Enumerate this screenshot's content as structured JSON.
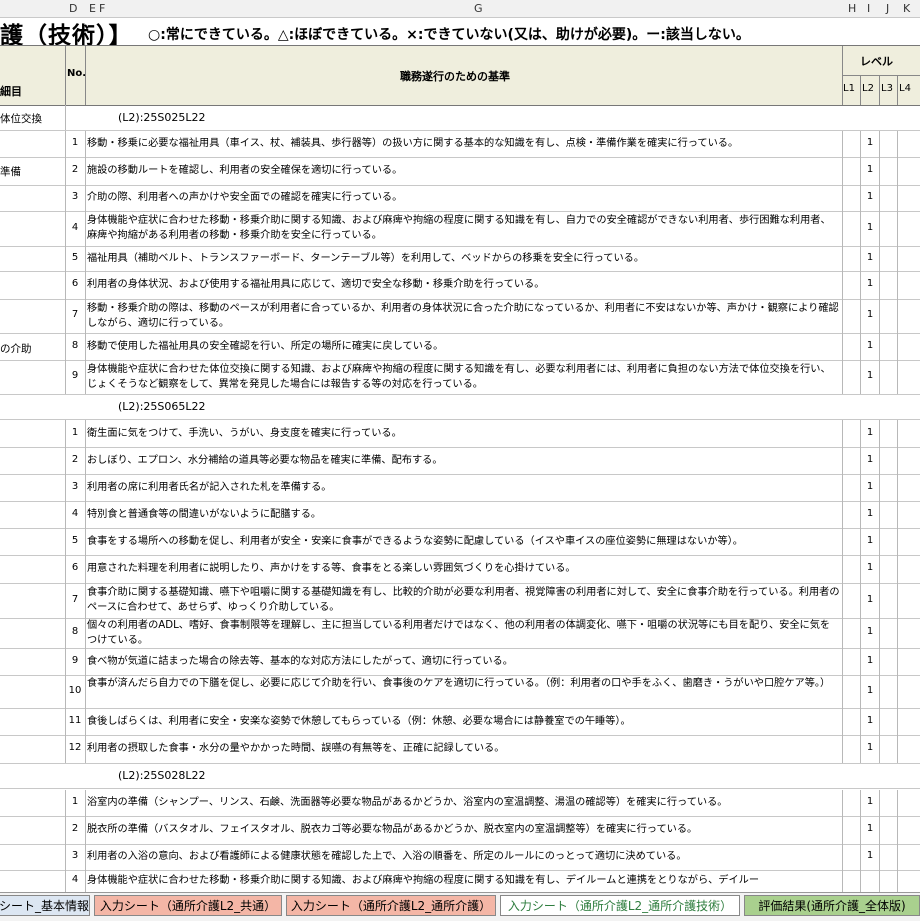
{
  "column_letters": [
    "D",
    "E",
    "F",
    "G",
    "H",
    "I",
    "J",
    "K"
  ],
  "title": "護（技術）】",
  "legend": "○:常にできている。△:ほぼできている。×:できていない(又は、助けが必要)。ー:該当しない。",
  "header": {
    "left": "細目",
    "no": "No.",
    "criteria": "職務遂行のための基準",
    "level": "レベル",
    "levels": [
      "L1",
      "L2",
      "L3",
      "L4"
    ]
  },
  "sections": [
    {
      "code": "(L2):25S025L22",
      "left": "体位交換"
    },
    {
      "code": "(L2):25S065L22",
      "left": ""
    },
    {
      "code": "(L2):25S028L22",
      "left": ""
    }
  ],
  "left_labels": [
    "準備",
    "の介助"
  ],
  "rows": [
    {
      "no": "1",
      "text": "移動・移乗に必要な福祉用具（車イス、杖、補装具、歩行器等）の扱い方に関する基本的な知識を有し、点検・準備作業を確実に行っている。",
      "lvl": "1"
    },
    {
      "no": "2",
      "text": "施設の移動ルートを確認し、利用者の安全確保を適切に行っている。",
      "lvl": "1"
    },
    {
      "no": "3",
      "text": "介助の際、利用者への声かけや安全面での確認を確実に行っている。",
      "lvl": "1"
    },
    {
      "no": "4",
      "text": "身体機能や症状に合わせた移動・移乗介助に関する知識、および麻痺や拘縮の程度に関する知識を有し、自力での安全確認ができない利用者、歩行困難な利用者、麻痺や拘縮がある利用者の移動・移乗介助を安全に行っている。",
      "lvl": "1"
    },
    {
      "no": "5",
      "text": "福祉用具（補助ベルト、トランスファーボード、ターンテーブル等）を利用して、ベッドからの移乗を安全に行っている。",
      "lvl": "1"
    },
    {
      "no": "6",
      "text": "利用者の身体状況、および使用する福祉用具に応じて、適切で安全な移動・移乗介助を行っている。",
      "lvl": "1"
    },
    {
      "no": "7",
      "text": "移動・移乗介助の際は、移動のペースが利用者に合っているか、利用者の身体状況に合った介助になっているか、利用者に不安はないか等、声かけ・観察により確認しながら、適切に行っている。",
      "lvl": "1"
    },
    {
      "no": "8",
      "text": "移動で使用した福祉用具の安全確認を行い、所定の場所に確実に戻している。",
      "lvl": "1"
    },
    {
      "no": "9",
      "text": "身体機能や症状に合わせた体位交換に関する知識、および麻痺や拘縮の程度に関する知識を有し、必要な利用者には、利用者に負担のない方法で体位交換を行い、じょくそうなど観察をして、異常を発見した場合には報告する等の対応を行っている。",
      "lvl": "1"
    },
    {
      "no": "1",
      "text": "衛生面に気をつけて、手洗い、うがい、身支度を確実に行っている。",
      "lvl": "1"
    },
    {
      "no": "2",
      "text": "おしぼり、エプロン、水分補給の道具等必要な物品を確実に準備、配布する。",
      "lvl": "1"
    },
    {
      "no": "3",
      "text": "利用者の席に利用者氏名が記入された札を準備する。",
      "lvl": "1"
    },
    {
      "no": "4",
      "text": "特別食と普通食等の間違いがないように配膳する。",
      "lvl": "1"
    },
    {
      "no": "5",
      "text": "食事をする場所への移動を促し、利用者が安全・安楽に食事ができるような姿勢に配慮している（イスや車イスの座位姿勢に無理はないか等）。",
      "lvl": "1"
    },
    {
      "no": "6",
      "text": "用意された料理を利用者に説明したり、声かけをする等、食事をとる楽しい雰囲気づくりを心掛けている。",
      "lvl": "1"
    },
    {
      "no": "7",
      "text": "食事介助に関する基礎知識、嚥下や咀嚼に関する基礎知識を有し、比較的介助が必要な利用者、視覚障害の利用者に対して、安全に食事介助を行っている。利用者のペースに合わせて、あせらず、ゆっくり介助している。",
      "lvl": "1"
    },
    {
      "no": "8",
      "text": "個々の利用者のADL、嗜好、食事制限等を理解し、主に担当している利用者だけではなく、他の利用者の体調変化、嚥下・咀嚼の状況等にも目を配り、安全に気をつけている。",
      "lvl": "1"
    },
    {
      "no": "9",
      "text": "食べ物が気道に詰まった場合の除去等、基本的な対応方法にしたがって、適切に行っている。",
      "lvl": "1"
    },
    {
      "no": "10",
      "text": "食事が済んだら自力での下膳を促し、必要に応じて介助を行い、食事後のケアを適切に行っている。（例：利用者の口や手をふく、歯磨き・うがいや口腔ケア等。）",
      "lvl": "1"
    },
    {
      "no": "11",
      "text": "食後しばらくは、利用者に安全・安楽な姿勢で休憩してもらっている（例：休憩、必要な場合には静養室での午睡等）。",
      "lvl": "1"
    },
    {
      "no": "12",
      "text": "利用者の摂取した食事・水分の量やかかった時間、誤嚥の有無等を、正確に記録している。",
      "lvl": "1"
    },
    {
      "no": "1",
      "text": "浴室内の準備（シャンプー、リンス、石鹸、洗面器等必要な物品があるかどうか、浴室内の室温調整、湯温の確認等）を確実に行っている。",
      "lvl": "1"
    },
    {
      "no": "2",
      "text": "脱衣所の準備（バスタオル、フェイスタオル、脱衣カゴ等必要な物品があるかどうか、脱衣室内の室温調整等）を確実に行っている。",
      "lvl": "1"
    },
    {
      "no": "3",
      "text": "利用者の入浴の意向、および看護師による健康状態を確認した上で、入浴の順番を、所定のルールにのっとって適切に決めている。",
      "lvl": "1"
    },
    {
      "no": "4",
      "text": "身体機能や症状に合わせた移動・移乗介助に関する知識、および麻痺や拘縮の程度に関する知識を有し、デイルームと連携をとりながら、デイルー",
      "lvl": ""
    }
  ],
  "tabs": [
    {
      "label": "シート_基本情報",
      "bg": "#dce6f2"
    },
    {
      "label": "入力シート（通所介護L2_共通）",
      "bg": "#f4b6a6"
    },
    {
      "label": "入力シート（通所介護L2_通所介護）",
      "bg": "#f4b6a6"
    },
    {
      "label": "入力シート（通所介護L2_通所介護技術）",
      "bg": "#ffffff"
    },
    {
      "label": "評価結果(通所介護_全体版)",
      "bg": "#a9d08e"
    }
  ]
}
